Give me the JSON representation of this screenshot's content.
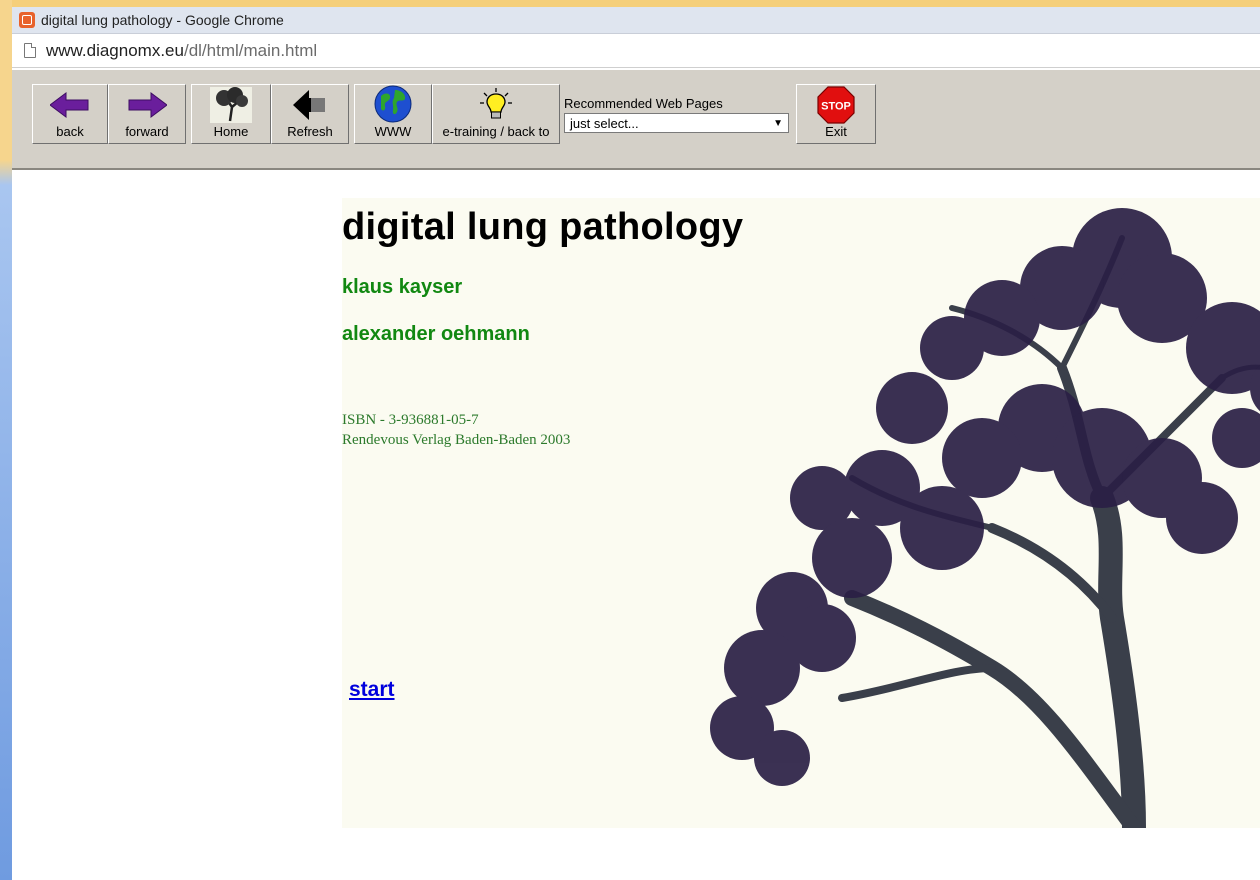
{
  "window": {
    "title": "digital lung pathology - Google Chrome"
  },
  "address": {
    "host": "www.diagnomx.eu",
    "path": "/dl/html/main.html"
  },
  "toolbar": {
    "back": "back",
    "forward": "forward",
    "home": "Home",
    "refresh": "Refresh",
    "www": "WWW",
    "etraining": "e-training / back to",
    "recommended_label": "Recommended Web Pages",
    "recommended_selected": "just select...",
    "stop_sign_text": "STOP",
    "exit": "Exit"
  },
  "content": {
    "title": "digital lung pathology",
    "authors": [
      "klaus kayser",
      "alexander oehmann"
    ],
    "isbn": "ISBN - 3-936881-05-7",
    "publisher": "Rendevous Verlag Baden-Baden 2003",
    "start_link": "start"
  },
  "colors": {
    "author_green": "#118811",
    "link_blue": "#0000dd",
    "panel_bg": "#fbfbf1",
    "toolbar_bg": "#d4d0c8",
    "tree_foliage": "#2a1f45"
  },
  "icons": {
    "back": "arrow-left-icon",
    "forward": "arrow-right-icon",
    "home": "tree-home-icon",
    "refresh": "refresh-arrow-icon",
    "www": "globe-icon",
    "etraining": "lightbulb-icon",
    "exit": "stop-sign-icon"
  }
}
